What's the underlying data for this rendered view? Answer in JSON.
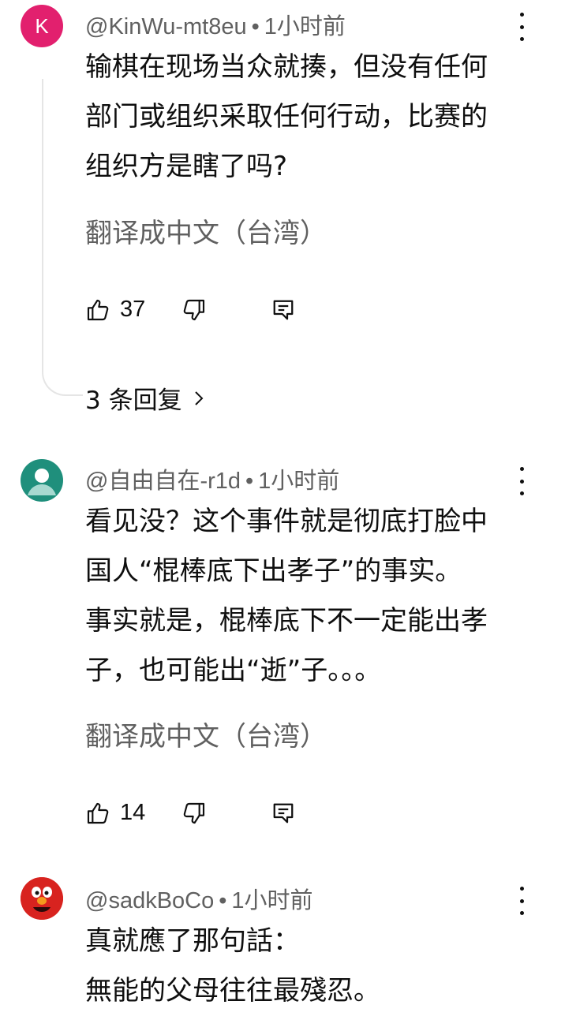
{
  "comments": [
    {
      "avatar_letter": "K",
      "author": "@KinWu-mt8eu",
      "time": "1小时前",
      "lines": [
        "输棋在现场当众就揍，但没有任何",
        "部门或组织采取任何行动，比赛的",
        "组织方是瞎了吗?"
      ],
      "translate": "翻译成中文（台湾）",
      "likes": "37",
      "replies": "3 条回复"
    },
    {
      "author": "@自由自在-r1d",
      "time": "1小时前",
      "lines": [
        "看见没？这个事件就是彻底打脸中",
        "国人“棍棒底下出孝子”的事实。",
        "事实就是，棍棒底下不一定能出孝",
        "子，也可能出“逝”子。。。"
      ],
      "translate": "翻译成中文（台湾）",
      "likes": "14"
    },
    {
      "author": "@sadkBoCo",
      "time": "1小时前",
      "lines": [
        "真就應了那句話：",
        "無能的父母往往最殘忍。"
      ]
    }
  ],
  "separator": "•",
  "icons": {
    "like": "thumbs-up-icon",
    "dislike": "thumbs-down-icon",
    "reply": "reply-comment-icon",
    "more": "more-vertical-icon",
    "chevron": "chevron-right-icon"
  },
  "colors": {
    "avatar_k": "#e2206e",
    "avatar_generic": "#1f8f7c",
    "avatar_elmo": "#d8231f",
    "meta_gray": "#606060"
  }
}
